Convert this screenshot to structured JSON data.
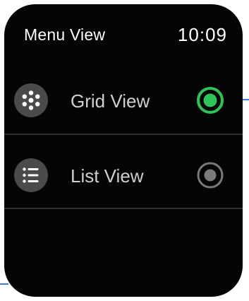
{
  "header": {
    "title": "Menu View",
    "time": "10:09"
  },
  "menu": {
    "items": [
      {
        "label": "Grid View",
        "icon": "grid-dots-icon",
        "selected": true
      },
      {
        "label": "List View",
        "icon": "list-icon",
        "selected": false
      }
    ]
  },
  "colors": {
    "screen_background": "#050505",
    "icon_background": "#4a4a4a",
    "selected_radio": "#2fc45a",
    "unselected_radio": "#7a7a7a",
    "connector": "#3f7fd6"
  }
}
